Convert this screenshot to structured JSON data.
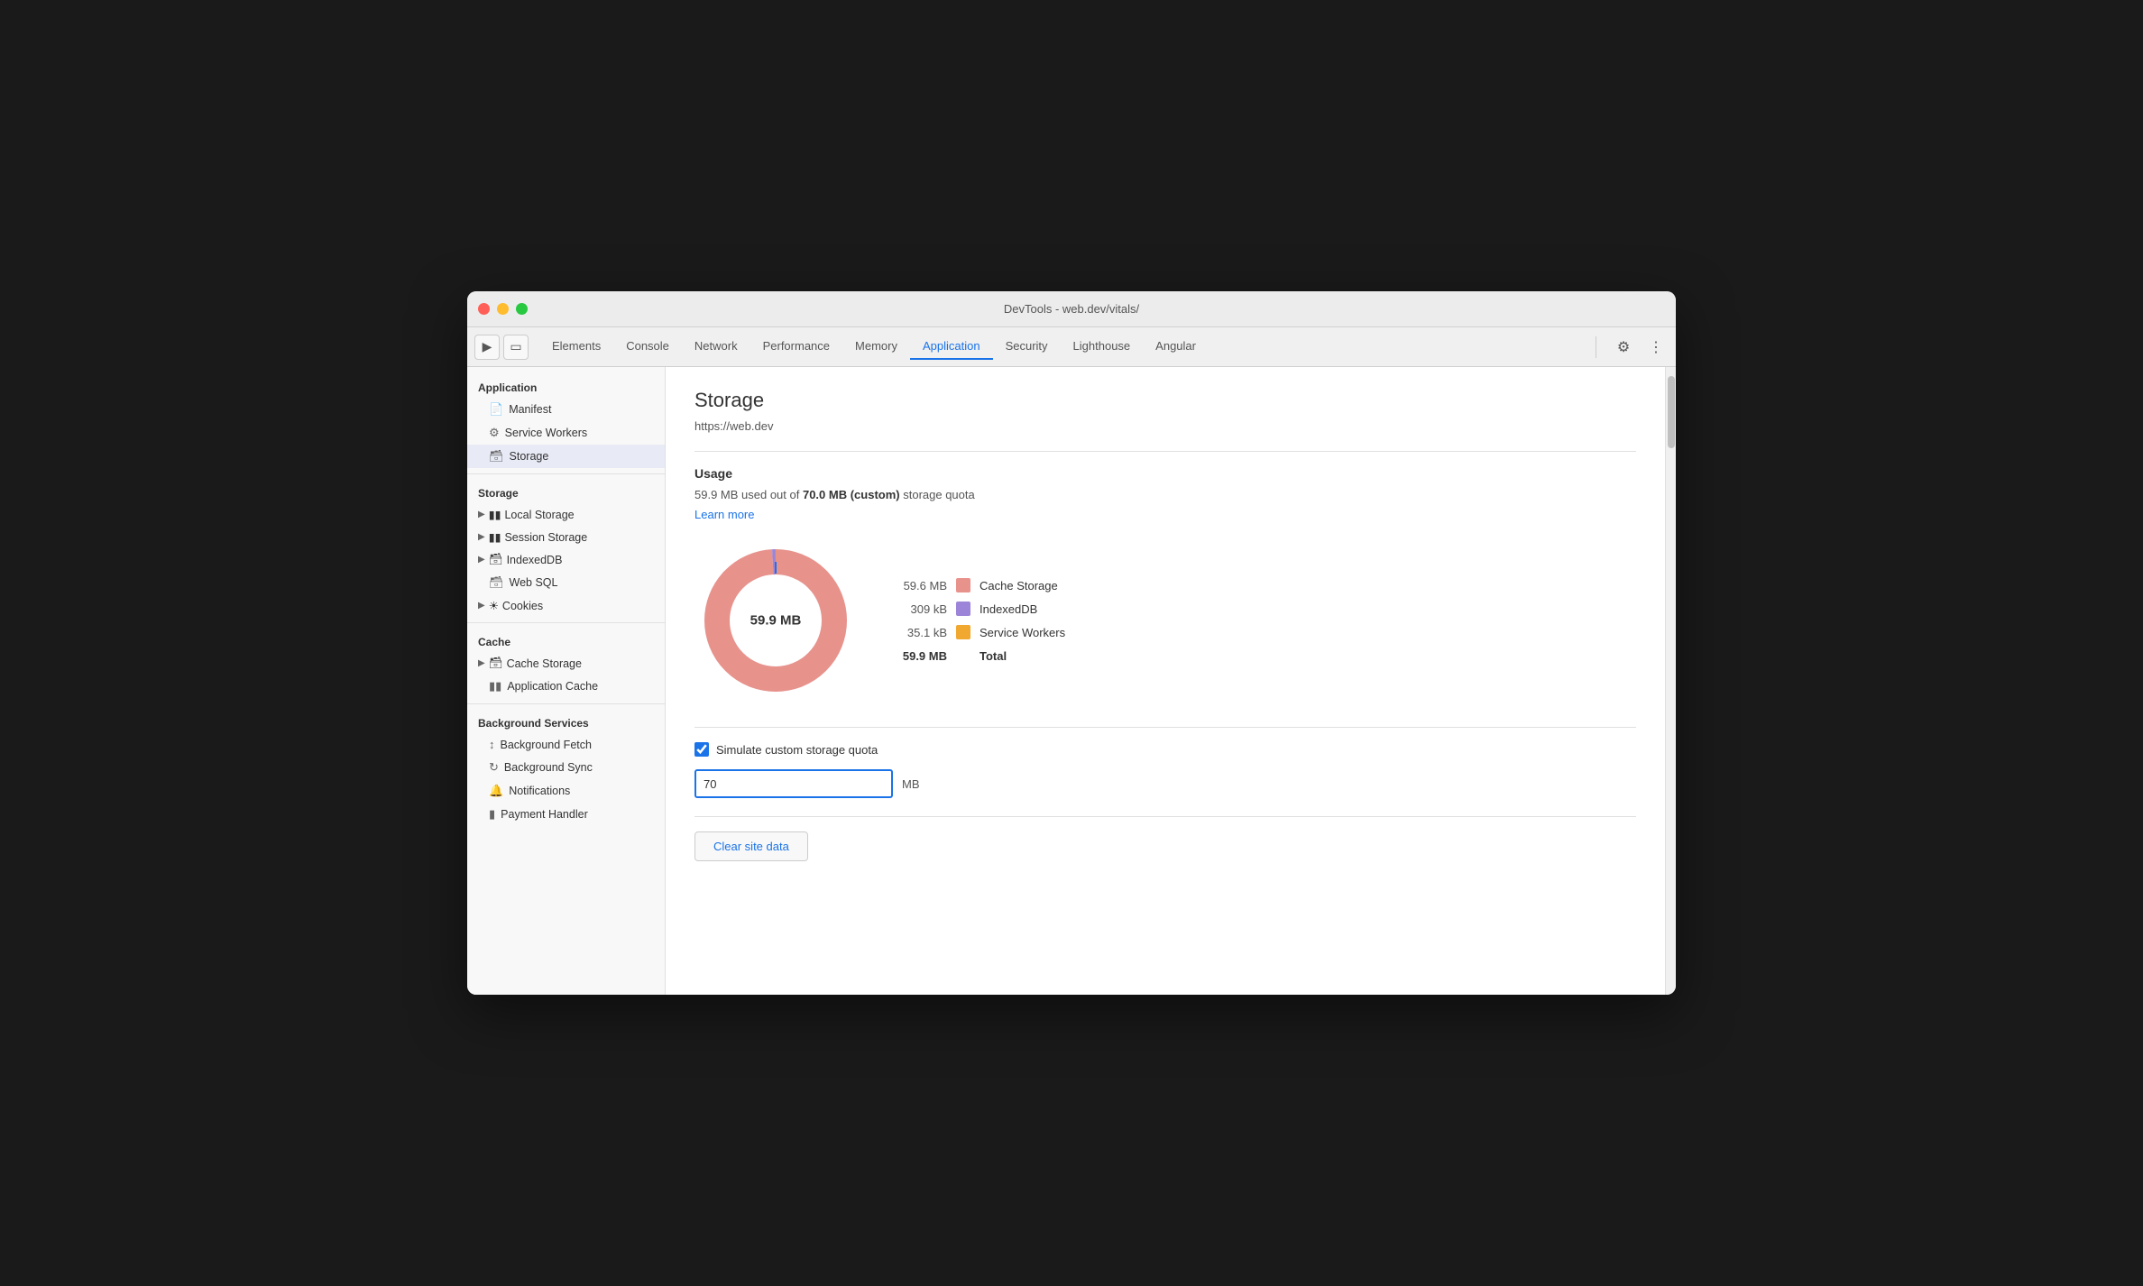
{
  "window": {
    "title": "DevTools - web.dev/vitals/"
  },
  "tabs": [
    {
      "label": "Elements",
      "active": false
    },
    {
      "label": "Console",
      "active": false
    },
    {
      "label": "Network",
      "active": false
    },
    {
      "label": "Performance",
      "active": false
    },
    {
      "label": "Memory",
      "active": false
    },
    {
      "label": "Application",
      "active": true
    },
    {
      "label": "Security",
      "active": false
    },
    {
      "label": "Lighthouse",
      "active": false
    },
    {
      "label": "Angular",
      "active": false
    }
  ],
  "sidebar": {
    "application_section": "Application",
    "items_app": [
      {
        "label": "Manifest",
        "icon": "📄"
      },
      {
        "label": "Service Workers",
        "icon": "⚙️"
      },
      {
        "label": "Storage",
        "icon": "🗄️",
        "active": true
      }
    ],
    "storage_section": "Storage",
    "items_storage": [
      {
        "label": "Local Storage",
        "expandable": true
      },
      {
        "label": "Session Storage",
        "expandable": true
      },
      {
        "label": "IndexedDB",
        "expandable": true
      },
      {
        "label": "Web SQL",
        "expandable": false
      },
      {
        "label": "Cookies",
        "expandable": true
      }
    ],
    "cache_section": "Cache",
    "items_cache": [
      {
        "label": "Cache Storage",
        "expandable": true
      },
      {
        "label": "Application Cache",
        "expandable": false
      }
    ],
    "background_services_section": "Background Services",
    "items_bg": [
      {
        "label": "Background Fetch",
        "icon": "↕"
      },
      {
        "label": "Background Sync",
        "icon": "↺"
      },
      {
        "label": "Notifications",
        "icon": "🔔"
      },
      {
        "label": "Payment Handler",
        "icon": "💳"
      }
    ]
  },
  "content": {
    "title": "Storage",
    "url": "https://web.dev",
    "usage_section": "Usage",
    "usage_description_prefix": "59.9 MB used out of ",
    "usage_bold": "70.0 MB (custom)",
    "usage_description_suffix": " storage quota",
    "learn_more": "Learn more",
    "donut_center_label": "59.9 MB",
    "legend": [
      {
        "value": "59.6 MB",
        "color": "#e8928c",
        "label": "Cache Storage"
      },
      {
        "value": "309 kB",
        "color": "#9c85d8",
        "label": "IndexedDB"
      },
      {
        "value": "35.1 kB",
        "color": "#f0a830",
        "label": "Service Workers"
      },
      {
        "value": "59.9 MB",
        "color": "",
        "label": "Total",
        "bold": true
      }
    ],
    "checkbox_label": "Simulate custom storage quota",
    "checkbox_checked": true,
    "quota_value": "70",
    "quota_unit": "MB",
    "clear_button": "Clear site data"
  },
  "icons": {
    "cursor": "⬛",
    "device": "📱",
    "gear": "⚙",
    "more": "⋮"
  }
}
